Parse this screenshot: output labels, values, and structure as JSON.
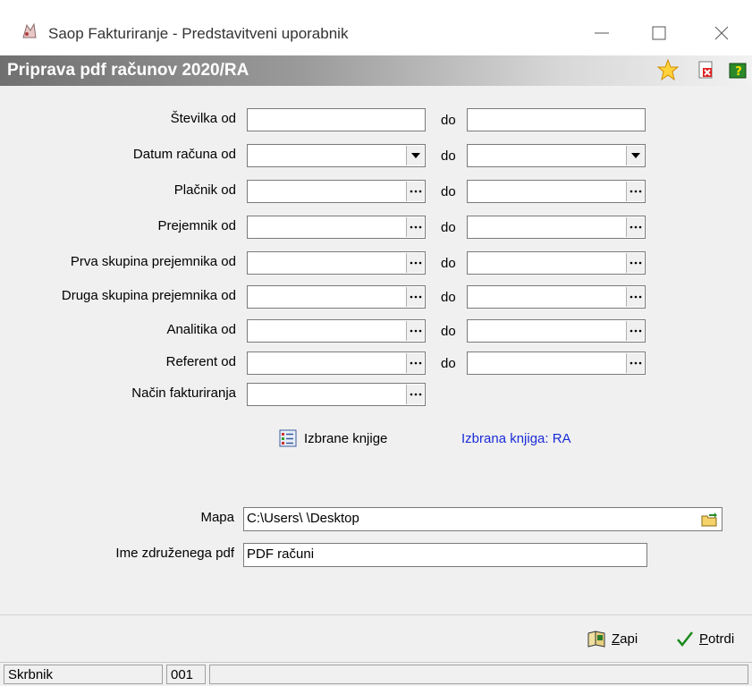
{
  "window": {
    "title": "Saop Fakturiranje - Predstavitveni uporabnik"
  },
  "header": {
    "title": "Priprava pdf računov 2020/RA"
  },
  "form": {
    "do_label": "do",
    "rows": [
      {
        "label": "Številka od",
        "type": "text"
      },
      {
        "label": "Datum računa od",
        "type": "dropdown"
      },
      {
        "label": "Plačnik od",
        "type": "lookup"
      },
      {
        "label": "Prejemnik od",
        "type": "lookup"
      },
      {
        "label": "Prva skupina prejemnika od",
        "type": "lookup"
      },
      {
        "label": "Druga skupina prejemnika od",
        "type": "lookup"
      },
      {
        "label": "Analitika od",
        "type": "lookup"
      },
      {
        "label": "Referent od",
        "type": "lookup"
      }
    ],
    "nacin_label": "Način fakturiranja",
    "books_button": "Izbrane knjige",
    "selected_book": "Izbrana knjiga: RA",
    "mapa_label": "Mapa",
    "mapa_value": "C:\\Users\\        \\Desktop",
    "ime_label": "Ime združenega pdf",
    "ime_value": "PDF računi"
  },
  "actions": {
    "zapri": "Zapri",
    "potrdi": "Potrdi"
  },
  "status": {
    "user": "Skrbnik",
    "code": "001"
  },
  "icons": [
    "app-icon",
    "star-icon",
    "close-doc-icon",
    "help-icon",
    "dropdown-arrow-icon",
    "ellipsis-icon",
    "list-icon",
    "folder-browse-icon",
    "book-close-icon",
    "checkmark-icon"
  ]
}
